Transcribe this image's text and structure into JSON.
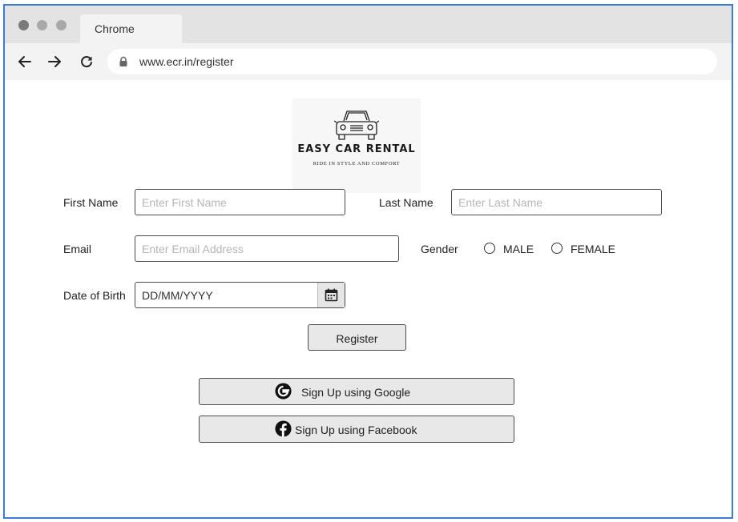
{
  "browser": {
    "tab_title": "Chrome",
    "url": "www.ecr.in/register"
  },
  "logo": {
    "title": "EASY CAR RENTAL",
    "tagline": "RIDE IN STYLE AND COMFORT"
  },
  "form": {
    "first_name": {
      "label": "First Name",
      "placeholder": "Enter First Name"
    },
    "last_name": {
      "label": "Last Name",
      "placeholder": "Enter Last Name"
    },
    "email": {
      "label": "Email",
      "placeholder": "Enter Email Address"
    },
    "gender": {
      "label": "Gender",
      "options": [
        "MALE",
        "FEMALE"
      ]
    },
    "dob": {
      "label": "Date of Birth",
      "value": "DD/MM/YYYY"
    },
    "register_label": "Register"
  },
  "social": {
    "google_label": "Sign Up using Google",
    "facebook_label": "Sign Up using Facebook"
  },
  "colors": {
    "window_border": "#3d7bd9",
    "button_bg": "#e8e8e8",
    "placeholder": "#b5b5b5"
  }
}
